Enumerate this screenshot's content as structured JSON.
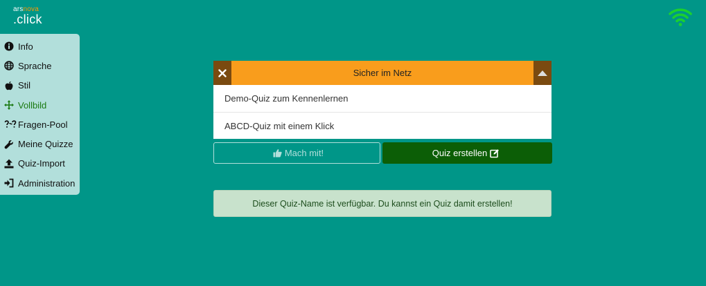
{
  "app": {
    "logo_top_ars": "ars",
    "logo_top_nova": "nova",
    "logo_bottom": ".click",
    "status_icon": "wifi-icon"
  },
  "sidebar": {
    "items": [
      {
        "label": "Info",
        "icon": "info-icon"
      },
      {
        "label": "Sprache",
        "icon": "globe-icon"
      },
      {
        "label": "Stil",
        "icon": "apple-icon"
      },
      {
        "label": "Vollbild",
        "icon": "move-arrows-icon",
        "active": true
      },
      {
        "label": "Fragen-Pool",
        "icon": "question-pool-icon"
      },
      {
        "label": "Meine Quizze",
        "icon": "wrench-icon"
      },
      {
        "label": "Quiz-Import",
        "icon": "upload-icon"
      },
      {
        "label": "Administration",
        "icon": "sign-in-icon"
      }
    ]
  },
  "quiz": {
    "input_value": "Sicher im Netz",
    "clear_icon": "close-icon",
    "toggle_icon": "caret-up-icon",
    "suggestions": [
      "Demo-Quiz zum Kennenlernen",
      "ABCD-Quiz mit einem Klick"
    ]
  },
  "actions": {
    "join_label": "Mach mit!",
    "join_icon": "thumbs-up-icon",
    "create_label": "Quiz erstellen",
    "create_icon": "edit-icon"
  },
  "message": {
    "text": "Dieser Quiz-Name ist verfügbar. Du kannst ein Quiz damit erstellen!"
  },
  "colors": {
    "background": "#009688",
    "sidebar": "#b2dfdb",
    "accent_orange": "#f99d1c",
    "create_button": "#0c5e06",
    "active_item": "#1b7a12",
    "message_bg": "#c8e2cc"
  }
}
